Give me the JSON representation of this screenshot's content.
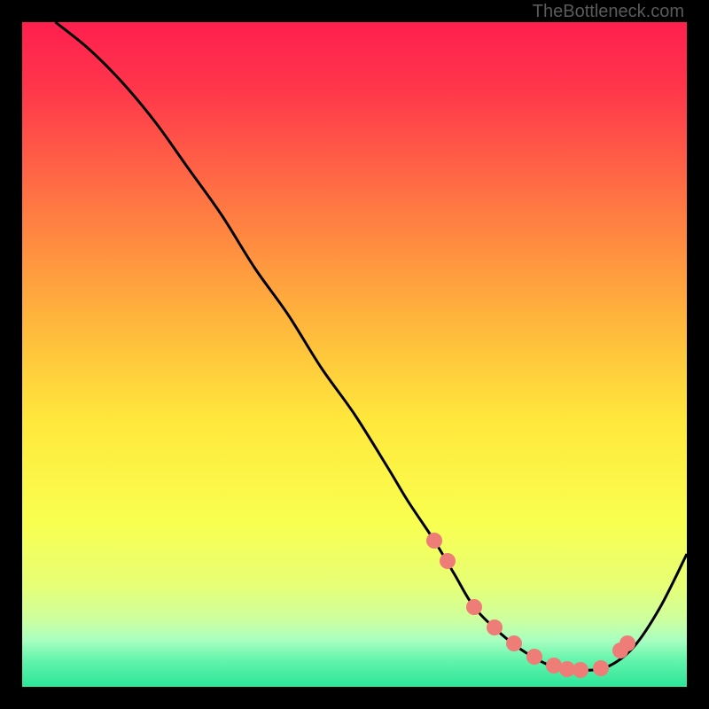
{
  "watermark": "TheBottleneck.com",
  "colors": {
    "black": "#000000",
    "marker": "#ee7d77",
    "curve": "#000000",
    "gradient_stops": [
      {
        "pct": 0,
        "color": "#ff1f4e"
      },
      {
        "pct": 10,
        "color": "#ff364b"
      },
      {
        "pct": 25,
        "color": "#ff6e44"
      },
      {
        "pct": 45,
        "color": "#ffb63c"
      },
      {
        "pct": 60,
        "color": "#ffe83c"
      },
      {
        "pct": 75,
        "color": "#f9ff4f"
      },
      {
        "pct": 85,
        "color": "#e6ff77"
      },
      {
        "pct": 90,
        "color": "#ccffa0"
      },
      {
        "pct": 93,
        "color": "#a8ffc0"
      },
      {
        "pct": 96,
        "color": "#63f4ac"
      },
      {
        "pct": 100,
        "color": "#2de598"
      }
    ]
  },
  "chart_data": {
    "type": "line",
    "title": "",
    "xlabel": "",
    "ylabel": "",
    "xlim": [
      0,
      100
    ],
    "ylim": [
      0,
      100
    ],
    "series": [
      {
        "name": "bottleneck-curve",
        "x": [
          5,
          10,
          15,
          20,
          25,
          30,
          35,
          40,
          45,
          50,
          55,
          58,
          62,
          65,
          68,
          72,
          76,
          80,
          84,
          88,
          92,
          96,
          100
        ],
        "y": [
          100,
          96,
          91,
          85,
          78,
          71,
          63,
          56,
          48,
          41,
          33,
          28,
          22,
          17,
          12,
          8,
          5,
          3,
          2.5,
          3,
          6,
          12,
          20
        ]
      }
    ],
    "markers": {
      "name": "highlight-points",
      "x": [
        62,
        64,
        68,
        71,
        74,
        77,
        80,
        82,
        84,
        87,
        90,
        91
      ],
      "y": [
        22,
        19,
        12,
        9,
        6.5,
        4.5,
        3.2,
        2.7,
        2.5,
        2.8,
        5.5,
        6.5
      ]
    },
    "note": "Axes are normalized 0–100; no numeric tick labels are shown in the image."
  }
}
